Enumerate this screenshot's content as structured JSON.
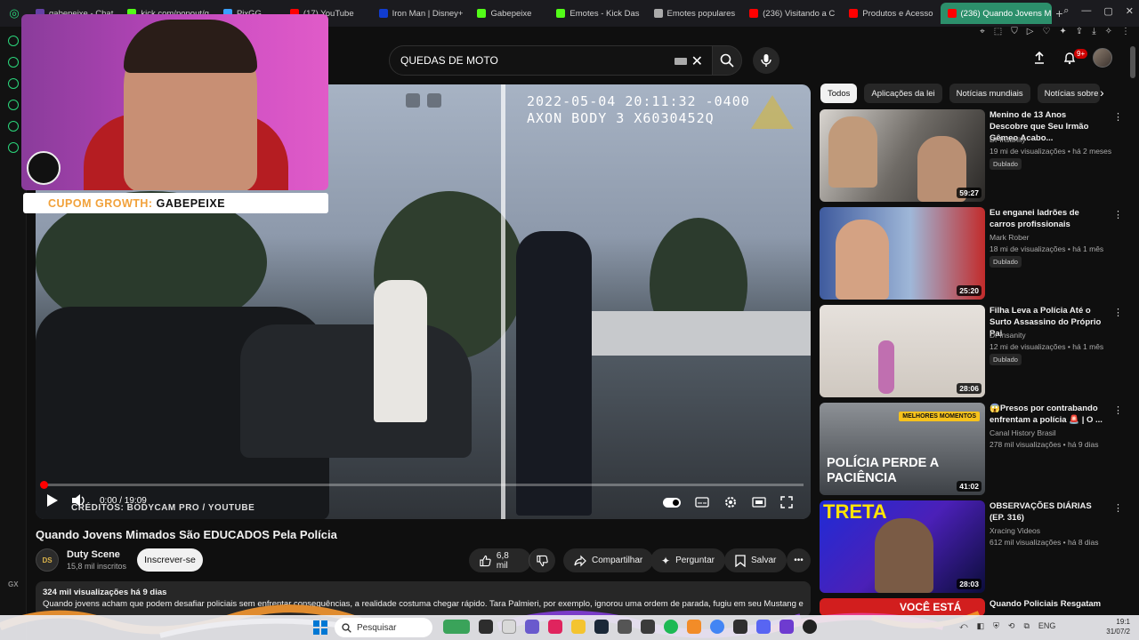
{
  "browser": {
    "tabs": [
      {
        "label": "gabepeixe - Chat",
        "color": "#6441a5"
      },
      {
        "label": "kick.com/popout/g",
        "color": "#53fc18"
      },
      {
        "label": "PixGG",
        "color": "#3aa0ff"
      },
      {
        "label": "(17) YouTube",
        "color": "#ff0000"
      },
      {
        "label": "Iron Man | Disney+",
        "color": "#113ccf"
      },
      {
        "label": "Gabepeixe",
        "color": "#53fc18"
      },
      {
        "label": "Emotes - Kick Das",
        "color": "#53fc18"
      },
      {
        "label": "Emotes populares",
        "color": "#aaaaaa"
      },
      {
        "label": "(236) Visitando a C",
        "color": "#ff0000"
      },
      {
        "label": "Produtos e Acesso",
        "color": "#ff0000"
      },
      {
        "label": "(236) Quando Jovens M",
        "color": "#ff0000",
        "active": true
      }
    ],
    "new_tab": "+"
  },
  "header": {
    "search_value": "QUEDAS DE MOTO",
    "notifications": "9+"
  },
  "overlay": {
    "coupon_label": "CUPOM GROWTH:",
    "coupon_code": "GABEPEIXE"
  },
  "player": {
    "timestamp_line1": "2022-05-04 20:11:32 -0400",
    "timestamp_line2": "AXON BODY 3 X6030452Q",
    "credits": "CRÉDITOS: BODYCAM PRO / YOUTUBE",
    "time": "0:00 / 19:09"
  },
  "video": {
    "title": "Quando Jovens Mimados São EDUCADOS Pela Polícia",
    "channel": "Duty Scene",
    "channel_avatar": "DS",
    "subscribers": "15,8 mil inscritos",
    "subscribe_label": "Inscrever-se",
    "likes": "6,8 mil",
    "share_label": "Compartilhar",
    "ask_label": "Perguntar",
    "save_label": "Salvar",
    "views_date": "324 mil visualizações  há 9 dias",
    "description": "Quando jovens acham que podem desafiar policiais sem enfrentar consequências, a realidade costuma chegar rápido. Tara Palmieri, por exemplo, ignorou uma ordem de parada, fugiu em seu Mustang e"
  },
  "chips": [
    "Todos",
    "Aplicações da lei",
    "Notícias mundiais",
    "Notícias sobre"
  ],
  "recommended": [
    {
      "title": "Menino de 13 Anos Descobre que Seu Irmão Gêmeo Acabo...",
      "channel": "Dr Insanity",
      "meta": "19 mi de visualizações • há 2 meses",
      "dub": "Dublado",
      "duration": "59:27"
    },
    {
      "title": "Eu enganei ladrões de carros profissionais",
      "channel": "Mark Rober",
      "meta": "18 mi de visualizações • há 1 mês",
      "dub": "Dublado",
      "duration": "25:20"
    },
    {
      "title": "Filha Leva a Polícia Até o Surto Assassino do Próprio Pai",
      "channel": "Dr Insanity",
      "meta": "12 mi de visualizações • há 1 mês",
      "dub": "Dublado",
      "duration": "28:06"
    },
    {
      "title": "😱Presos por contrabando enfrentam a polícia 🚨 | O ...",
      "channel": "Canal History Brasil",
      "meta": "278 mil visualizações • há 9 dias",
      "dub": "",
      "duration": "41:02",
      "thumb_badge": "MELHORES MOMENTOS",
      "thumb_text": "POLÍCIA PERDE A PACIÊNCIA"
    },
    {
      "title": "OBSERVAÇÕES DIÁRIAS (EP. 316)",
      "channel": "Xracing Videos",
      "meta": "612 mil visualizações • há 8 dias",
      "dub": "",
      "duration": "28:03",
      "thumb_text": "TRETA"
    },
    {
      "title": "Quando Policiais Resgatam",
      "channel": "",
      "meta": "",
      "dub": "",
      "duration": "",
      "thumb_text": "VOCÊ ESTÁ"
    }
  ],
  "taskbar": {
    "search_placeholder": "Pesquisar",
    "time": "19:1",
    "date": "31/07/2"
  }
}
